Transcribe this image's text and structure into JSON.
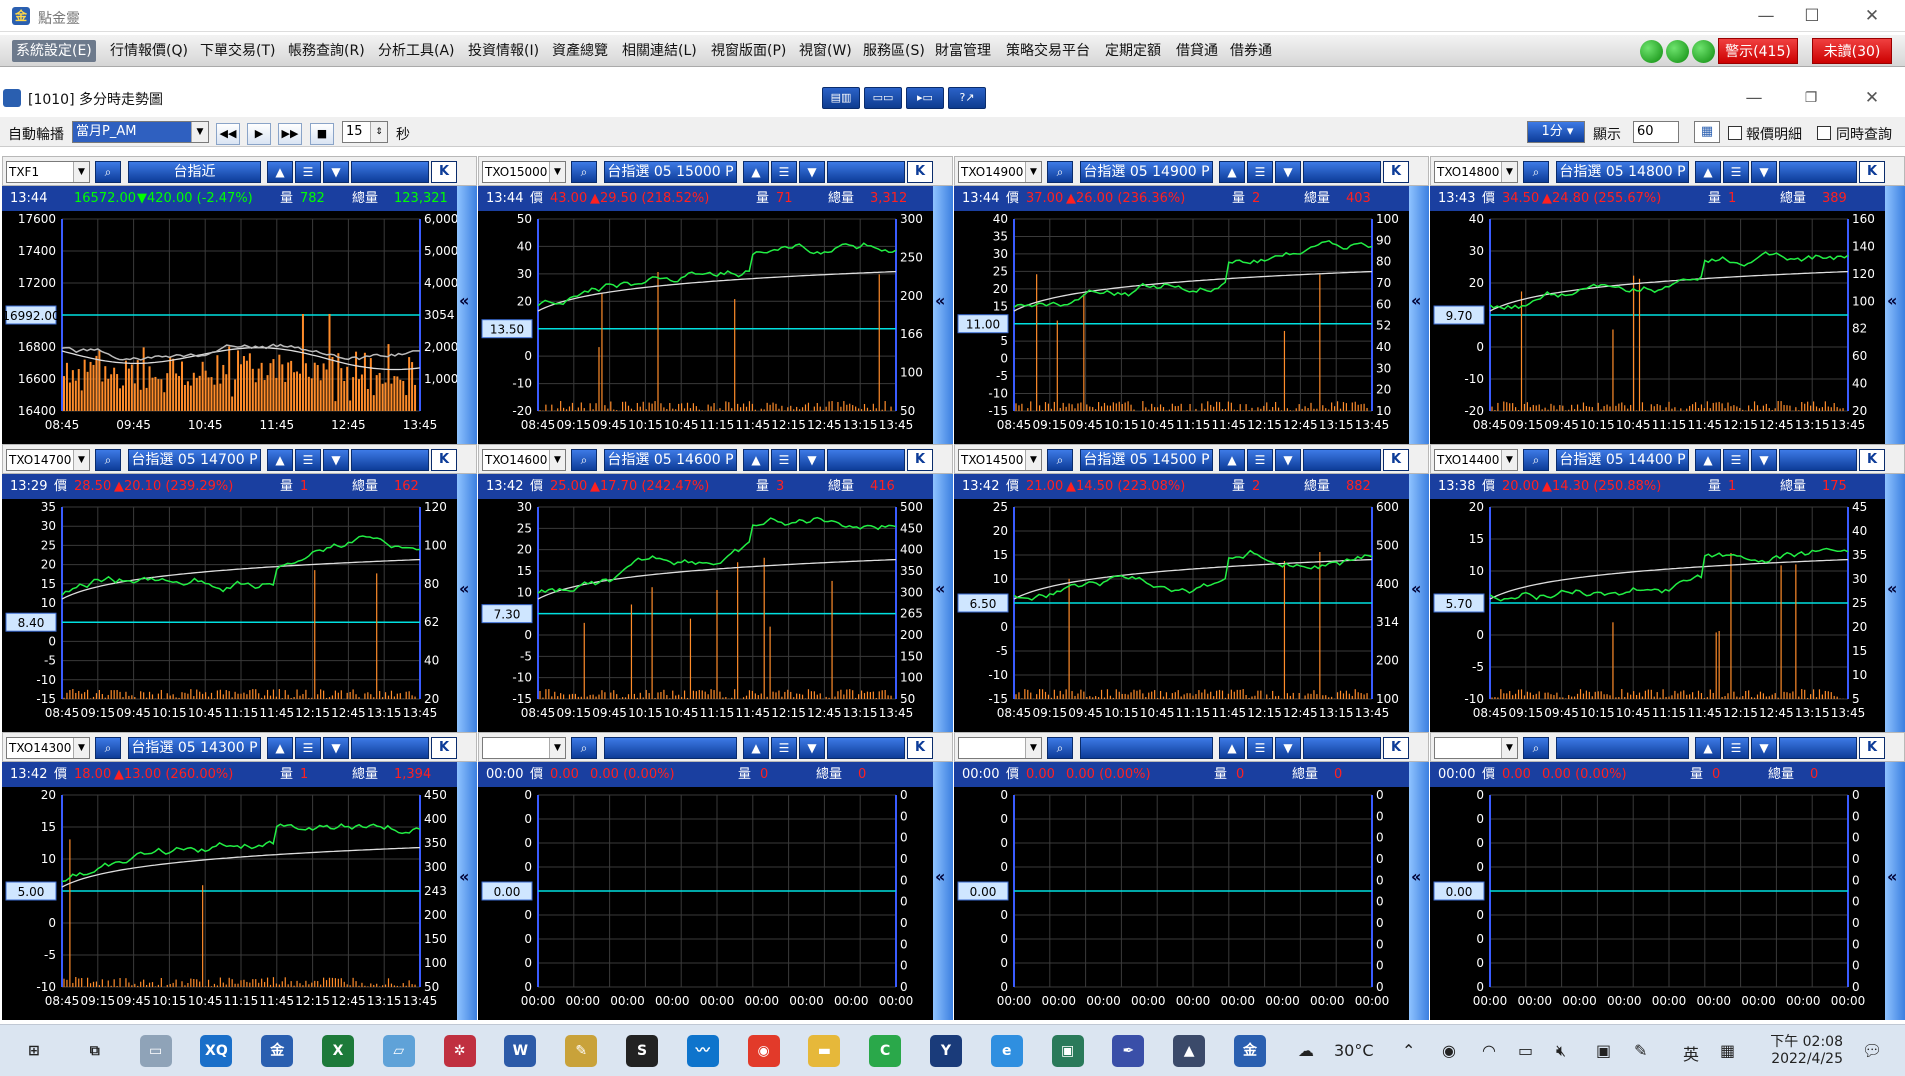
{
  "app": {
    "title": "點金靈"
  },
  "menu": {
    "items": [
      "系統設定(E)",
      "行情報價(Q)",
      "下單交易(T)",
      "帳務查詢(R)",
      "分析工具(A)",
      "投資情報(I)",
      "資產總覽",
      "相關連結(L)",
      "視窗版面(P)",
      "視窗(W)",
      "服務區(S)",
      "財富管理",
      "策略交易平台",
      "定期定額",
      "借貸通",
      "借券通"
    ],
    "alert_label": "警示(415)",
    "unread_label": "未讀(30)"
  },
  "subwindow": {
    "title": "[1010] 多分時走勢圖"
  },
  "toolbar": {
    "auto_rotate_label": "自動輪播",
    "rotate_select": "當月P_AM",
    "interval_value": "15",
    "seconds_label": "秒",
    "period_select": "1分",
    "display_label": "顯示",
    "display_value": "60",
    "quote_detail_label": "報價明細",
    "sync_query_label": "同時查詢"
  },
  "panels": [
    {
      "code": "TXF1",
      "name": "台指近",
      "time": "13:44",
      "price_label": "",
      "price": "16572.00",
      "change": "▼420.00 (-2.47%)",
      "up": false,
      "vol_label": "量",
      "vol": "782",
      "total_label": "總量",
      "total": "123,321",
      "ref": "16992.00",
      "left_ticks": [
        "17600",
        "17400",
        "17200",
        "",
        "16800",
        "16600",
        "16400"
      ],
      "right_ticks": [
        "6,000",
        "5,000",
        "4,000",
        "3054",
        "2,000",
        "1,000",
        ""
      ],
      "xticks": [
        "08:45",
        "09:45",
        "10:45",
        "11:45",
        "12:45",
        "13:45"
      ],
      "empty": false
    },
    {
      "code": "TXO15000",
      "name": "台指選 05 15000 P",
      "time": "13:44",
      "price_label": "價",
      "price": "43.00",
      "change": "▲29.50 (218.52%)",
      "up": true,
      "vol_label": "量",
      "vol": "71",
      "total_label": "總量",
      "total": "3,312",
      "ref": "13.50",
      "left_ticks": [
        "50",
        "40",
        "30",
        "20",
        "",
        "0",
        "-10",
        "-20"
      ],
      "right_ticks": [
        "300",
        "250",
        "200",
        "166",
        "100",
        "50"
      ],
      "xticks": [
        "08:45",
        "09:15",
        "09:45",
        "10:15",
        "10:45",
        "11:15",
        "11:45",
        "12:15",
        "12:45",
        "13:15",
        "13:45"
      ],
      "empty": false
    },
    {
      "code": "TXO14900",
      "name": "台指選 05 14900 P",
      "time": "13:44",
      "price_label": "價",
      "price": "37.00",
      "change": "▲26.00 (236.36%)",
      "up": true,
      "vol_label": "量",
      "vol": "2",
      "total_label": "總量",
      "total": "403",
      "ref": "11.00",
      "left_ticks": [
        "40",
        "35",
        "30",
        "25",
        "20",
        "15",
        "",
        "5",
        "0",
        "-5",
        "-10",
        "-15"
      ],
      "right_ticks": [
        "100",
        "90",
        "80",
        "70",
        "60",
        "52",
        "40",
        "30",
        "20",
        "10"
      ],
      "xticks": [
        "08:45",
        "09:15",
        "09:45",
        "10:15",
        "10:45",
        "11:15",
        "11:45",
        "12:15",
        "12:45",
        "13:15",
        "13:45"
      ],
      "empty": false
    },
    {
      "code": "TXO14800",
      "name": "台指選 05 14800 P",
      "time": "13:43",
      "price_label": "價",
      "price": "34.50",
      "change": "▲24.80 (255.67%)",
      "up": true,
      "vol_label": "量",
      "vol": "1",
      "total_label": "總量",
      "total": "389",
      "ref": "9.70",
      "left_ticks": [
        "40",
        "30",
        "20",
        "",
        "0",
        "-10",
        "-20"
      ],
      "right_ticks": [
        "160",
        "140",
        "120",
        "100",
        "82",
        "60",
        "40",
        "20"
      ],
      "xticks": [
        "08:45",
        "09:15",
        "09:45",
        "10:15",
        "10:45",
        "11:15",
        "11:45",
        "12:15",
        "12:45",
        "13:15",
        "13:45"
      ],
      "empty": false
    },
    {
      "code": "TXO14700",
      "name": "台指選 05 14700 P",
      "time": "13:29",
      "price_label": "價",
      "price": "28.50",
      "change": "▲20.10 (239.29%)",
      "up": true,
      "vol_label": "量",
      "vol": "1",
      "total_label": "總量",
      "total": "162",
      "ref": "8.40",
      "left_ticks": [
        "35",
        "30",
        "25",
        "20",
        "15",
        "10",
        "",
        "0",
        "-5",
        "-10",
        "-15"
      ],
      "right_ticks": [
        "120",
        "100",
        "80",
        "62",
        "40",
        "20"
      ],
      "xticks": [
        "08:45",
        "09:15",
        "09:45",
        "10:15",
        "10:45",
        "11:15",
        "11:45",
        "12:15",
        "12:45",
        "13:15",
        "13:45"
      ],
      "empty": false
    },
    {
      "code": "TXO14600",
      "name": "台指選 05 14600 P",
      "time": "13:42",
      "price_label": "價",
      "price": "25.00",
      "change": "▲17.70 (242.47%)",
      "up": true,
      "vol_label": "量",
      "vol": "3",
      "total_label": "總量",
      "total": "416",
      "ref": "7.30",
      "left_ticks": [
        "30",
        "25",
        "20",
        "15",
        "10",
        "",
        "0",
        "-5",
        "-10",
        "-15"
      ],
      "right_ticks": [
        "500",
        "450",
        "400",
        "350",
        "300",
        "265",
        "200",
        "150",
        "100",
        "50"
      ],
      "xticks": [
        "08:45",
        "09:15",
        "09:45",
        "10:15",
        "10:45",
        "11:15",
        "11:45",
        "12:15",
        "12:45",
        "13:15",
        "13:45"
      ],
      "empty": false
    },
    {
      "code": "TXO14500",
      "name": "台指選 05 14500 P",
      "time": "13:42",
      "price_label": "價",
      "price": "21.00",
      "change": "▲14.50 (223.08%)",
      "up": true,
      "vol_label": "量",
      "vol": "2",
      "total_label": "總量",
      "total": "882",
      "ref": "6.50",
      "left_ticks": [
        "25",
        "20",
        "15",
        "10",
        "",
        "0",
        "-5",
        "-10",
        "-15"
      ],
      "right_ticks": [
        "600",
        "500",
        "400",
        "314",
        "200",
        "100"
      ],
      "xticks": [
        "08:45",
        "09:15",
        "09:45",
        "10:15",
        "10:45",
        "11:15",
        "11:45",
        "12:15",
        "12:45",
        "13:15",
        "13:45"
      ],
      "empty": false
    },
    {
      "code": "TXO14400",
      "name": "台指選 05 14400 P",
      "time": "13:38",
      "price_label": "價",
      "price": "20.00",
      "change": "▲14.30 (250.88%)",
      "up": true,
      "vol_label": "量",
      "vol": "1",
      "total_label": "總量",
      "total": "175",
      "ref": "5.70",
      "left_ticks": [
        "20",
        "15",
        "10",
        "",
        "0",
        "-5",
        "-10"
      ],
      "right_ticks": [
        "45",
        "40",
        "35",
        "30",
        "25",
        "20",
        "15",
        "10",
        "5"
      ],
      "xticks": [
        "08:45",
        "09:15",
        "09:45",
        "10:15",
        "10:45",
        "11:15",
        "11:45",
        "12:15",
        "12:45",
        "13:15",
        "13:45"
      ],
      "empty": false
    },
    {
      "code": "TXO14300",
      "name": "台指選 05 14300 P",
      "time": "13:42",
      "price_label": "價",
      "price": "18.00",
      "change": "▲13.00 (260.00%)",
      "up": true,
      "vol_label": "量",
      "vol": "1",
      "total_label": "總量",
      "total": "1,394",
      "ref": "5.00",
      "left_ticks": [
        "20",
        "15",
        "10",
        "",
        "0",
        "-5",
        "-10"
      ],
      "right_ticks": [
        "450",
        "400",
        "350",
        "300",
        "243",
        "200",
        "150",
        "100",
        "50"
      ],
      "xticks": [
        "08:45",
        "09:15",
        "09:45",
        "10:15",
        "10:45",
        "11:15",
        "11:45",
        "12:15",
        "12:45",
        "13:15",
        "13:45"
      ],
      "empty": false
    },
    {
      "code": "",
      "name": "",
      "time": "00:00",
      "price_label": "價",
      "price": "0.00",
      "change": "0.00 (0.00%)",
      "up": true,
      "vol_label": "量",
      "vol": "0",
      "total_label": "總量",
      "total": "0",
      "ref": "0.00",
      "left_ticks": [
        "0",
        "0",
        "0",
        "0",
        "",
        "0",
        "0",
        "0",
        "0"
      ],
      "right_ticks": [
        "0",
        "0",
        "0",
        "0",
        "0",
        "0",
        "0",
        "0",
        "0",
        "0"
      ],
      "xticks": [
        "00:00",
        "00:00",
        "00:00",
        "00:00",
        "00:00",
        "00:00",
        "00:00",
        "00:00",
        "00:00"
      ],
      "empty": true
    },
    {
      "code": "",
      "name": "",
      "time": "00:00",
      "price_label": "價",
      "price": "0.00",
      "change": "0.00 (0.00%)",
      "up": true,
      "vol_label": "量",
      "vol": "0",
      "total_label": "總量",
      "total": "0",
      "ref": "0.00",
      "left_ticks": [
        "0",
        "0",
        "0",
        "0",
        "",
        "0",
        "0",
        "0",
        "0"
      ],
      "right_ticks": [
        "0",
        "0",
        "0",
        "0",
        "0",
        "0",
        "0",
        "0",
        "0",
        "0"
      ],
      "xticks": [
        "00:00",
        "00:00",
        "00:00",
        "00:00",
        "00:00",
        "00:00",
        "00:00",
        "00:00",
        "00:00"
      ],
      "empty": true
    },
    {
      "code": "",
      "name": "",
      "time": "00:00",
      "price_label": "價",
      "price": "0.00",
      "change": "0.00 (0.00%)",
      "up": true,
      "vol_label": "量",
      "vol": "0",
      "total_label": "總量",
      "total": "0",
      "ref": "0.00",
      "left_ticks": [
        "0",
        "0",
        "0",
        "0",
        "",
        "0",
        "0",
        "0",
        "0"
      ],
      "right_ticks": [
        "0",
        "0",
        "0",
        "0",
        "0",
        "0",
        "0",
        "0",
        "0",
        "0"
      ],
      "xticks": [
        "00:00",
        "00:00",
        "00:00",
        "00:00",
        "00:00",
        "00:00",
        "00:00",
        "00:00",
        "00:00"
      ],
      "empty": true
    }
  ],
  "taskbar": {
    "apps": [
      "start-icon",
      "task-view-icon",
      "photos-icon",
      "xq-icon",
      "gold-app-icon",
      "excel-icon",
      "notes-icon",
      "pinwheel-icon",
      "word-icon",
      "paint-icon",
      "s-app-icon",
      "wave-app-icon",
      "chrome-icon",
      "folder-icon",
      "green-c-icon",
      "ymf-icon",
      "ie-icon",
      "window-icon",
      "pen-icon",
      "triangle-icon",
      "gold-app-active-icon"
    ],
    "weather": "30°C",
    "ime": "英",
    "time": "下午 02:08",
    "date": "2022/4/25"
  },
  "colors": {
    "up": "#ff2020",
    "down": "#00ff00",
    "price_line": "#22ee44",
    "avg_line": "#dddddd",
    "volume": "#ff8c2a",
    "ref_line": "#00e0e0"
  }
}
